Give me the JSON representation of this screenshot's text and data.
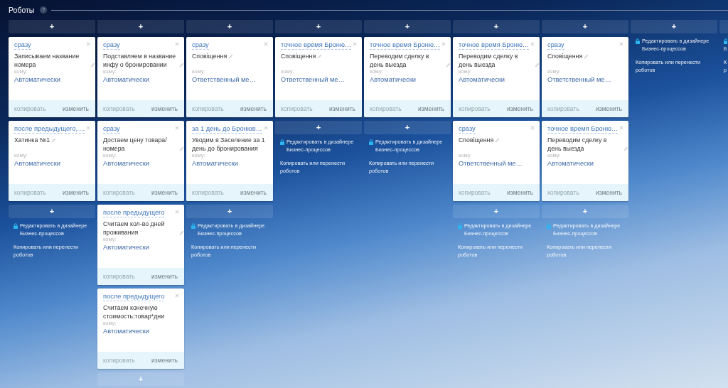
{
  "header": {
    "title": "Роботы",
    "help": "?"
  },
  "columns": [
    {
      "cut_off": false,
      "top_add": "+",
      "robots": [
        {
          "trigger": "сразу",
          "title": "Записываем название номера",
          "edit_icon": true,
          "to_label": "кому:",
          "to": "Автоматически",
          "copy": "копировать",
          "copy_disabled": true,
          "change": "изменить"
        },
        {
          "trigger": "после предыдущего, ...",
          "title": "Хатинка №1",
          "edit_icon": true,
          "to_label": "кому:",
          "to": "Автоматически",
          "copy": "копировать",
          "copy_disabled": true,
          "change": "изменить"
        }
      ],
      "bottom_add": "+",
      "edit_link": "Редактировать в дизайнере Бизнес-процессов",
      "copy_link": "Копировать или перенести роботов"
    },
    {
      "cut_off": false,
      "top_add": "+",
      "robots": [
        {
          "trigger": "сразу",
          "title": "Подставляем в название инфу о бронировании",
          "edit_icon": true,
          "to_label": "кому:",
          "to": "Автоматически",
          "copy": "копировать",
          "copy_disabled": true,
          "change": "изменить"
        },
        {
          "trigger": "сразу",
          "title": "Достаем цену товара/ номера",
          "edit_icon": true,
          "to_label": "кому:",
          "to": "Автоматически",
          "copy": "копировать",
          "copy_disabled": true,
          "change": "изменить"
        },
        {
          "trigger": "после предыдущего",
          "title": "Считаем кол-во дней проживания",
          "edit_icon": true,
          "to_label": "кому:",
          "to": "Автоматически",
          "copy": "копировать",
          "copy_disabled": true,
          "change": "изменить"
        },
        {
          "trigger": "после предыдущего",
          "title": "Считаем конечную стоимость:товар*дни",
          "edit_icon": false,
          "to_label": "кому:",
          "to": "Автоматически",
          "copy": "копировать",
          "copy_disabled": true,
          "change": "изменить"
        }
      ],
      "bottom_add": "+"
    },
    {
      "cut_off": false,
      "top_add": "+",
      "robots": [
        {
          "trigger": "сразу",
          "title": "Сповіщення",
          "edit_icon": true,
          "to_label": "кому:",
          "to": "Ответственный ме…",
          "copy": "копировать",
          "copy_disabled": true,
          "change": "изменить"
        },
        {
          "trigger": "за 1 день до Бронюв…",
          "title": "Уводим в Заселение за 1 день до бронирования",
          "edit_icon": false,
          "to_label": "кому:",
          "to": "Автоматически",
          "copy": "копировать",
          "copy_disabled": true,
          "change": "изменить"
        }
      ],
      "bottom_add": "+",
      "edit_link": "Редактировать в дизайнере Бизнес-процессов",
      "copy_link": "Копировать или перенести роботов"
    },
    {
      "cut_off": false,
      "top_add": "+",
      "robots": [
        {
          "trigger": "точное время Броню…",
          "title": "Сповіщення",
          "edit_icon": true,
          "to_label": "кому:",
          "to": "Ответственный ме…",
          "copy": "копировать",
          "copy_disabled": true,
          "change": "изменить"
        }
      ],
      "bottom_add": "+",
      "edit_link": "Редактировать в дизайнере Бизнес-процессов",
      "copy_link": "Копировать или перенести роботов"
    },
    {
      "cut_off": false,
      "top_add": "+",
      "robots": [
        {
          "trigger": "точное время Броню…",
          "title": "Переводим сделку в день выезда",
          "edit_icon": true,
          "to_label": "кому:",
          "to": "Автоматически",
          "copy": "копировать",
          "copy_disabled": true,
          "change": "изменить"
        }
      ],
      "bottom_add": "+",
      "edit_link": "Редактировать в дизайнере Бизнес-процессов",
      "copy_link": "Копировать или перенести роботов"
    },
    {
      "cut_off": false,
      "top_add": "+",
      "robots": [
        {
          "trigger": "точное время Броню…",
          "title": "Переводим сделку в день выезда",
          "edit_icon": true,
          "to_label": "кому:",
          "to": "Автоматически",
          "copy": "копировать",
          "copy_disabled": true,
          "change": "изменить"
        },
        {
          "trigger": "сразу",
          "title": "Сповіщення",
          "edit_icon": true,
          "to_label": "кому:",
          "to": "Ответственный ме…",
          "copy": "копировать",
          "copy_disabled": true,
          "change": "изменить"
        }
      ],
      "bottom_add": "+",
      "edit_link": "Редактировать в дизайнере Бизнес-процессов",
      "copy_link": "Копировать или перенести роботов"
    },
    {
      "cut_off": false,
      "top_add": "+",
      "robots": [
        {
          "trigger": "сразу",
          "title": "Сповіщення",
          "edit_icon": true,
          "to_label": "кому:",
          "to": "Ответственный ме…",
          "copy": "копировать",
          "copy_disabled": true,
          "change": "изменить"
        },
        {
          "trigger": "точное время Броню…",
          "title": "Переводим сделку в день выезда",
          "edit_icon": true,
          "to_label": "кому:",
          "to": "Автоматически",
          "copy": "копировать",
          "copy_disabled": true,
          "change": "изменить"
        }
      ],
      "bottom_add": "+",
      "edit_link": "Редактировать в дизайнере Бизнес-процессов",
      "copy_link": "Копировать или перенести роботов"
    },
    {
      "cut_off": false,
      "top_add": "+",
      "edit_link": "Редактировать в дизайнере Бизнес-процессов",
      "copy_link": "Копировать или перенести роботов"
    },
    {
      "cut_off": true,
      "edit_link": "Б",
      "copy_link": "К р"
    }
  ]
}
